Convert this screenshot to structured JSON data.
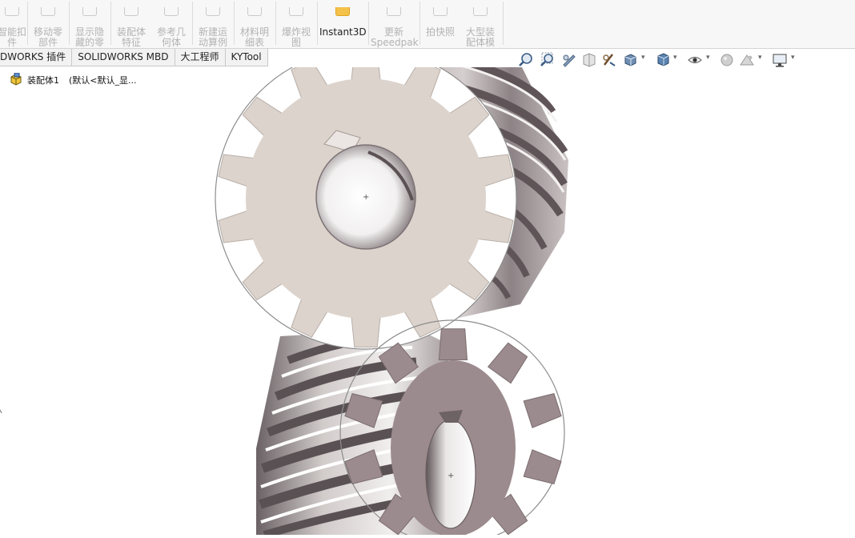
{
  "ribbon": {
    "items": [
      {
        "label": "智能扣\n件",
        "dropdown": false
      },
      {
        "label": "移动零\n部件",
        "dropdown": true
      },
      {
        "label": "显示隐\n藏的零\n部件",
        "dropdown": false
      },
      {
        "label": "装配体\n特征",
        "dropdown": true
      },
      {
        "label": "参考几\n何体",
        "dropdown": true
      },
      {
        "label": "新建运\n动算例",
        "dropdown": false
      },
      {
        "label": "材料明\n细表",
        "dropdown": false
      },
      {
        "label": "爆炸视\n图",
        "dropdown": true
      },
      {
        "label": "Instant3D",
        "dropdown": false
      },
      {
        "label": "更新\nSpeedpak",
        "dropdown": false
      },
      {
        "label": "拍快照",
        "dropdown": false
      },
      {
        "label": "大型装\n配体模\n式",
        "dropdown": false
      }
    ]
  },
  "tabs": [
    "DWORKS 插件",
    "SOLIDWORKS MBD",
    "大工程师",
    "KYTool"
  ],
  "tree": {
    "root_label": "装配体1",
    "config_label": "(默认<默认_显..."
  },
  "view_toolbar": {
    "icons": [
      "zoom-to-fit-icon",
      "zoom-to-area-icon",
      "previous-view-icon",
      "section-view-icon",
      "dynamic-annotation-icon",
      "view-orientation-icon",
      "display-style-icon",
      "hide-show-items-icon",
      "edit-appearance-icon",
      "apply-scene-icon",
      "view-settings-icon"
    ]
  },
  "colors": {
    "big_gear": "#dcd3cc",
    "small_gear": "#9c8b8e",
    "gear_shadow": "#6d6264",
    "highlight": "#ffffff"
  }
}
